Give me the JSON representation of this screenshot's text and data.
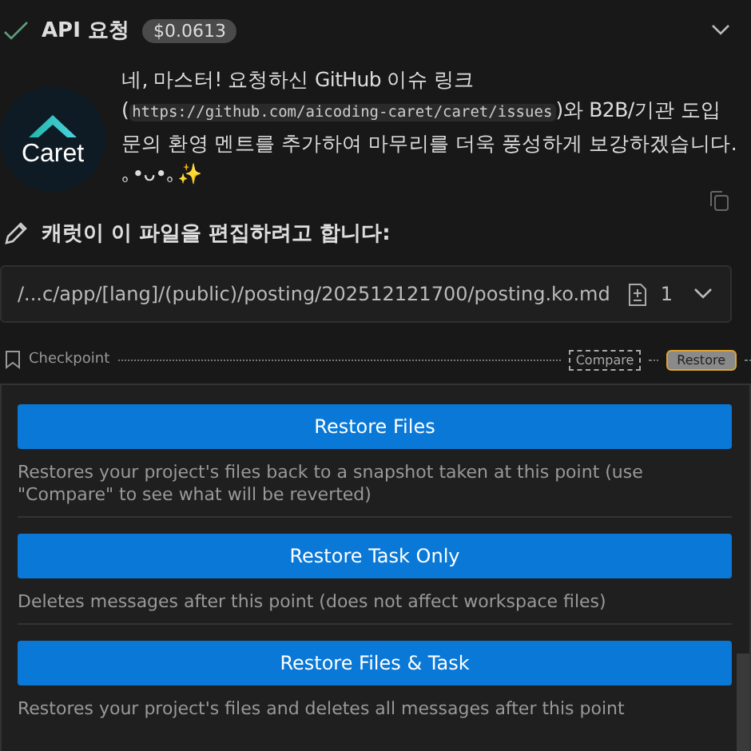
{
  "request": {
    "done": true,
    "title": "API 요청",
    "cost": "$0.0613",
    "expanded": false
  },
  "message": {
    "logo_text": "Caret",
    "parts": [
      {
        "kind": "text",
        "text": "네, 마스터! 요청하신 GitHub 이슈 링크 ("
      },
      {
        "kind": "code",
        "text": "https://github.com/aicoding-caret/caret/issues"
      },
      {
        "kind": "text",
        "text": ")와 B2B/기관 도입 문의 환영 멘트를 추가하여 마무리를 더욱 풍성하게 보강하겠습니다. ｡•ᴗ•｡✨"
      }
    ]
  },
  "edit": {
    "heading": "캐럿이 이 파일을 편집하려고 합니다:",
    "path": "/...c/app/[lang]/(public)/posting/202512121700/posting.ko.md",
    "count": "1",
    "expanded": false
  },
  "checkpoint": {
    "label": "Checkpoint",
    "buttons": [
      {
        "label": "Compare",
        "selected": false
      },
      {
        "label": "Restore",
        "selected": true
      }
    ]
  },
  "restore_options": [
    {
      "label": "Restore Files",
      "description": "Restores your project's files back to a snapshot taken at this point (use \"Compare\" to see what will be reverted)"
    },
    {
      "label": "Restore Task Only",
      "description": "Deletes messages after this point (does not affect workspace files)"
    },
    {
      "label": "Restore Files & Task",
      "description": "Restores your project's files and deletes all messages after this point"
    }
  ]
}
